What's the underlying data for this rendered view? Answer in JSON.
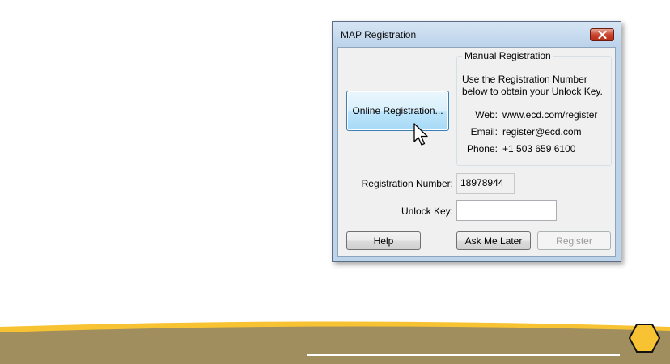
{
  "dialog": {
    "title": "MAP Registration",
    "online_registration_label": "Online Registration...",
    "manual": {
      "group_title": "Manual Registration",
      "description": "Use the Registration Number below to obtain your Unlock Key.",
      "contacts": [
        {
          "label": "Web:",
          "value": "www.ecd.com/register"
        },
        {
          "label": "Email:",
          "value": "register@ecd.com"
        },
        {
          "label": "Phone:",
          "value": "+1 503 659 6100"
        }
      ]
    },
    "registration_number_label": "Registration Number:",
    "registration_number_value": "18978944",
    "unlock_key_label": "Unlock Key:",
    "unlock_key_value": "",
    "help_label": "Help",
    "ask_me_later_label": "Ask Me Later",
    "register_label": "Register"
  },
  "colors": {
    "footer_band": "#a08e5e",
    "footer_stripe": "#f7c332",
    "footer_hexagon": "#f7c332",
    "footer_line": "#ffffff",
    "titlebar": "#bcd3ea",
    "close_button": "#c9452f"
  },
  "icons": {
    "close": "close-x-icon",
    "cursor": "mouse-pointer-icon",
    "footer_logo": "hexagon-icon"
  }
}
